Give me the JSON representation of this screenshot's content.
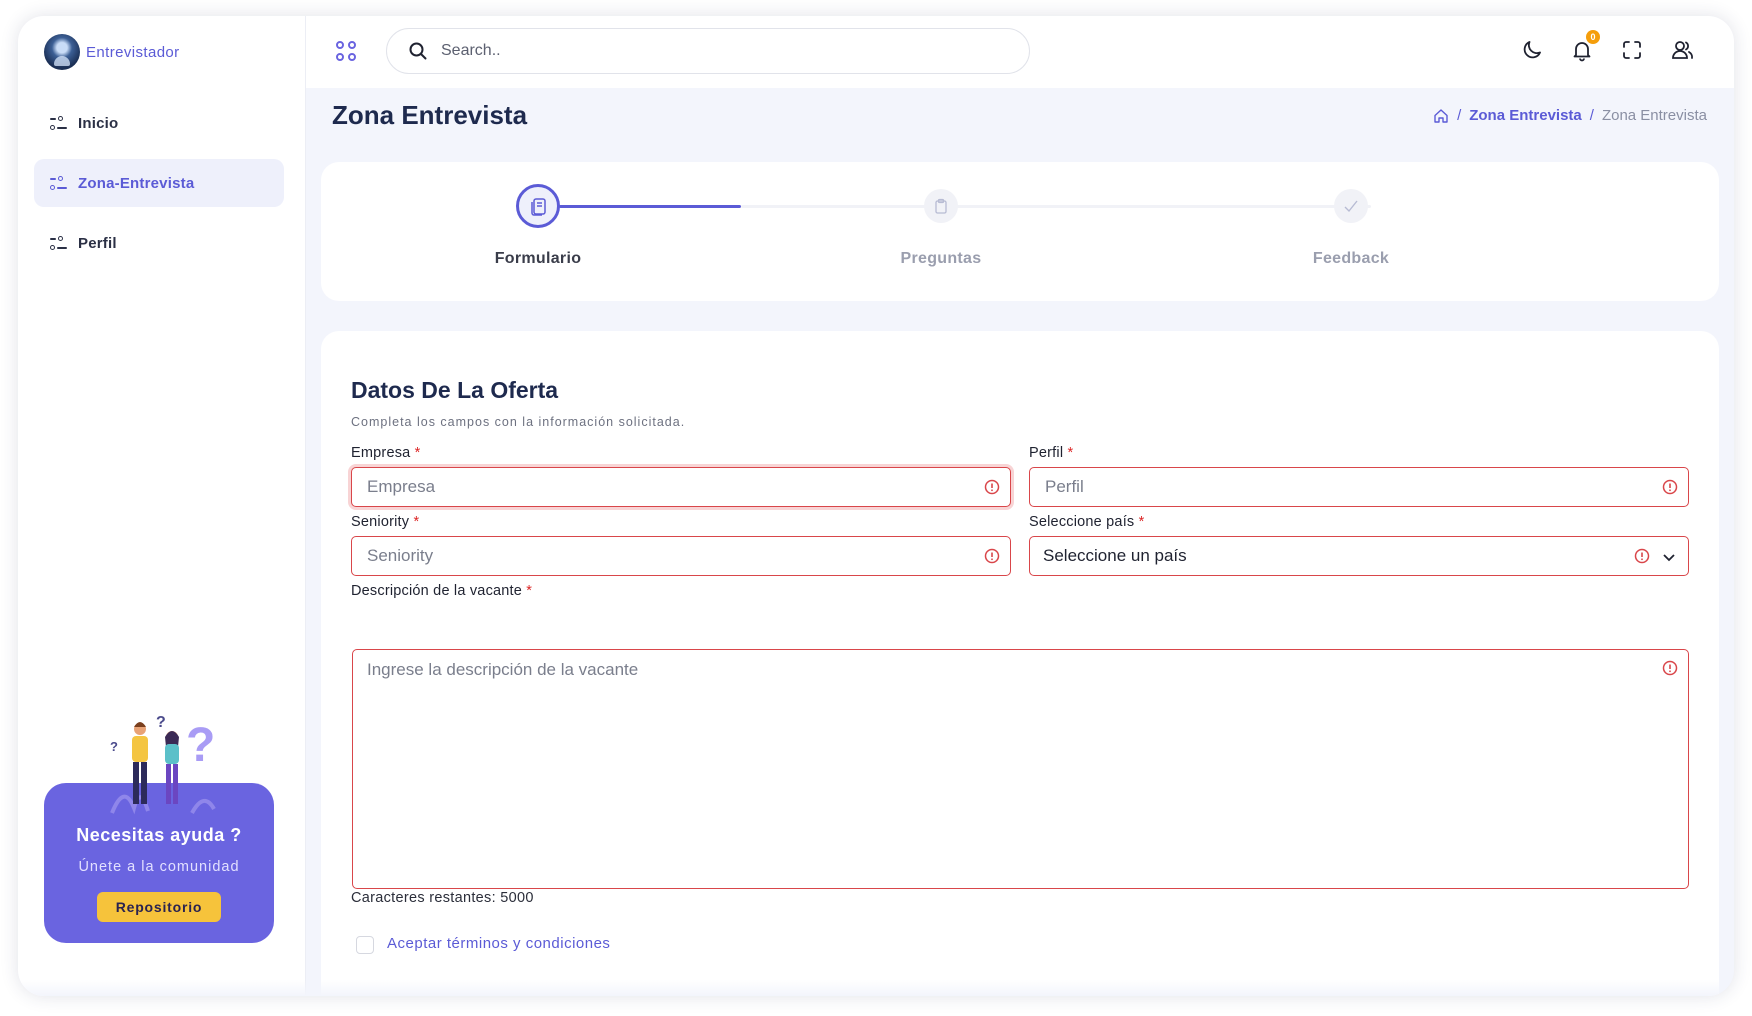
{
  "app": {
    "name": "Entrevistador"
  },
  "sidebar": {
    "items": [
      {
        "label": "Inicio",
        "active": false
      },
      {
        "label": "Zona-Entrevista",
        "active": true
      },
      {
        "label": "Perfil",
        "active": false
      }
    ],
    "help": {
      "title": "Necesitas ayuda ?",
      "subtitle": "Únete a la comunidad",
      "button": "Repositorio"
    }
  },
  "topbar": {
    "search_placeholder": "Search..",
    "notification_count": "0"
  },
  "page": {
    "title": "Zona Entrevista",
    "breadcrumb": {
      "link": "Zona Entrevista",
      "current": "Zona Entrevista"
    }
  },
  "stepper": {
    "steps": [
      {
        "label": "Formulario",
        "state": "active"
      },
      {
        "label": "Preguntas",
        "state": "pending"
      },
      {
        "label": "Feedback",
        "state": "pending"
      }
    ]
  },
  "form": {
    "title": "Datos De La Oferta",
    "subtitle": "Completa los campos con la información solicitada.",
    "required_mark": "*",
    "fields": {
      "empresa": {
        "label": "Empresa",
        "placeholder": "Empresa"
      },
      "perfil": {
        "label": "Perfil",
        "placeholder": "Perfil"
      },
      "seniority": {
        "label": "Seniority",
        "placeholder": "Seniority"
      },
      "pais": {
        "label": "Seleccione país",
        "value": "Seleccione un país"
      },
      "descripcion": {
        "label": "Descripción de la vacante",
        "placeholder": "Ingrese la descripción de la vacante"
      }
    },
    "chars_remaining": "Caracteres restantes: 5000",
    "terms_label": "Aceptar términos y condiciones"
  },
  "colors": {
    "accent": "#5b5bd6",
    "error": "#d9464a",
    "help_card": "#6a64e0",
    "help_button": "#f6c33b"
  }
}
